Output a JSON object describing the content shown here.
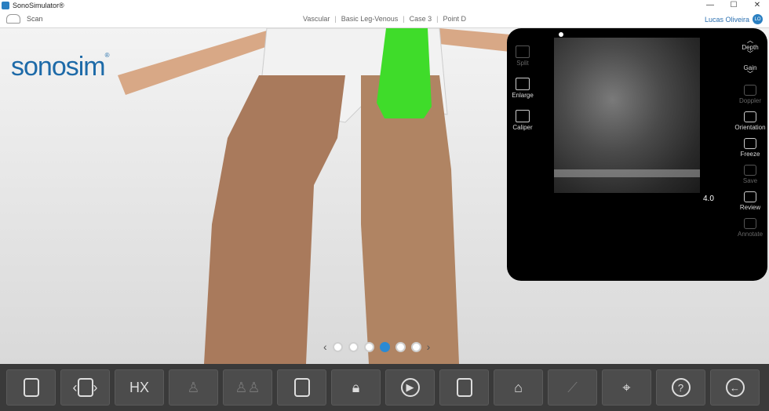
{
  "window": {
    "title": "SonoSimulator®",
    "controls": [
      "—",
      "☐",
      "✕"
    ]
  },
  "header": {
    "scan_label": "Scan",
    "breadcrumbs": [
      "Vascular",
      "Basic Leg-Venous",
      "Case 3",
      "Point D"
    ],
    "user_name": "Lucas Oliveira",
    "user_initials": "LO"
  },
  "logo": {
    "text": "sonosim",
    "mark": "®"
  },
  "pager": {
    "prev": "‹",
    "next": "›",
    "count": 6,
    "active_index": 3
  },
  "ultrasound": {
    "left_tools": [
      {
        "label": "Split",
        "enabled": false
      },
      {
        "label": "Enlarge",
        "enabled": true
      },
      {
        "label": "Caliper",
        "enabled": true
      }
    ],
    "right_tools": [
      {
        "label": "Depth",
        "enabled": true
      },
      {
        "label": "Gain",
        "enabled": true
      },
      {
        "label": "Doppler",
        "enabled": false
      },
      {
        "label": "Orientation",
        "enabled": true
      },
      {
        "label": "Freeze",
        "enabled": true
      },
      {
        "label": "Save",
        "enabled": false
      },
      {
        "label": "Review",
        "enabled": true
      },
      {
        "label": "Annotate",
        "enabled": false
      }
    ],
    "depth_value": "4.0"
  },
  "toolbar": {
    "hx_label": "HX",
    "buttons": [
      "case-info",
      "probe-nav",
      "history",
      "exam-1",
      "exam-2",
      "probe",
      "lock",
      "play",
      "checklist",
      "transducer",
      "syringe",
      "target",
      "help",
      "exit"
    ]
  },
  "colors": {
    "accent": "#2a8ad4",
    "panel_bg": "#000000",
    "toolbar_bg": "#3a3a3a",
    "probe_green": "#3fdc2a"
  }
}
